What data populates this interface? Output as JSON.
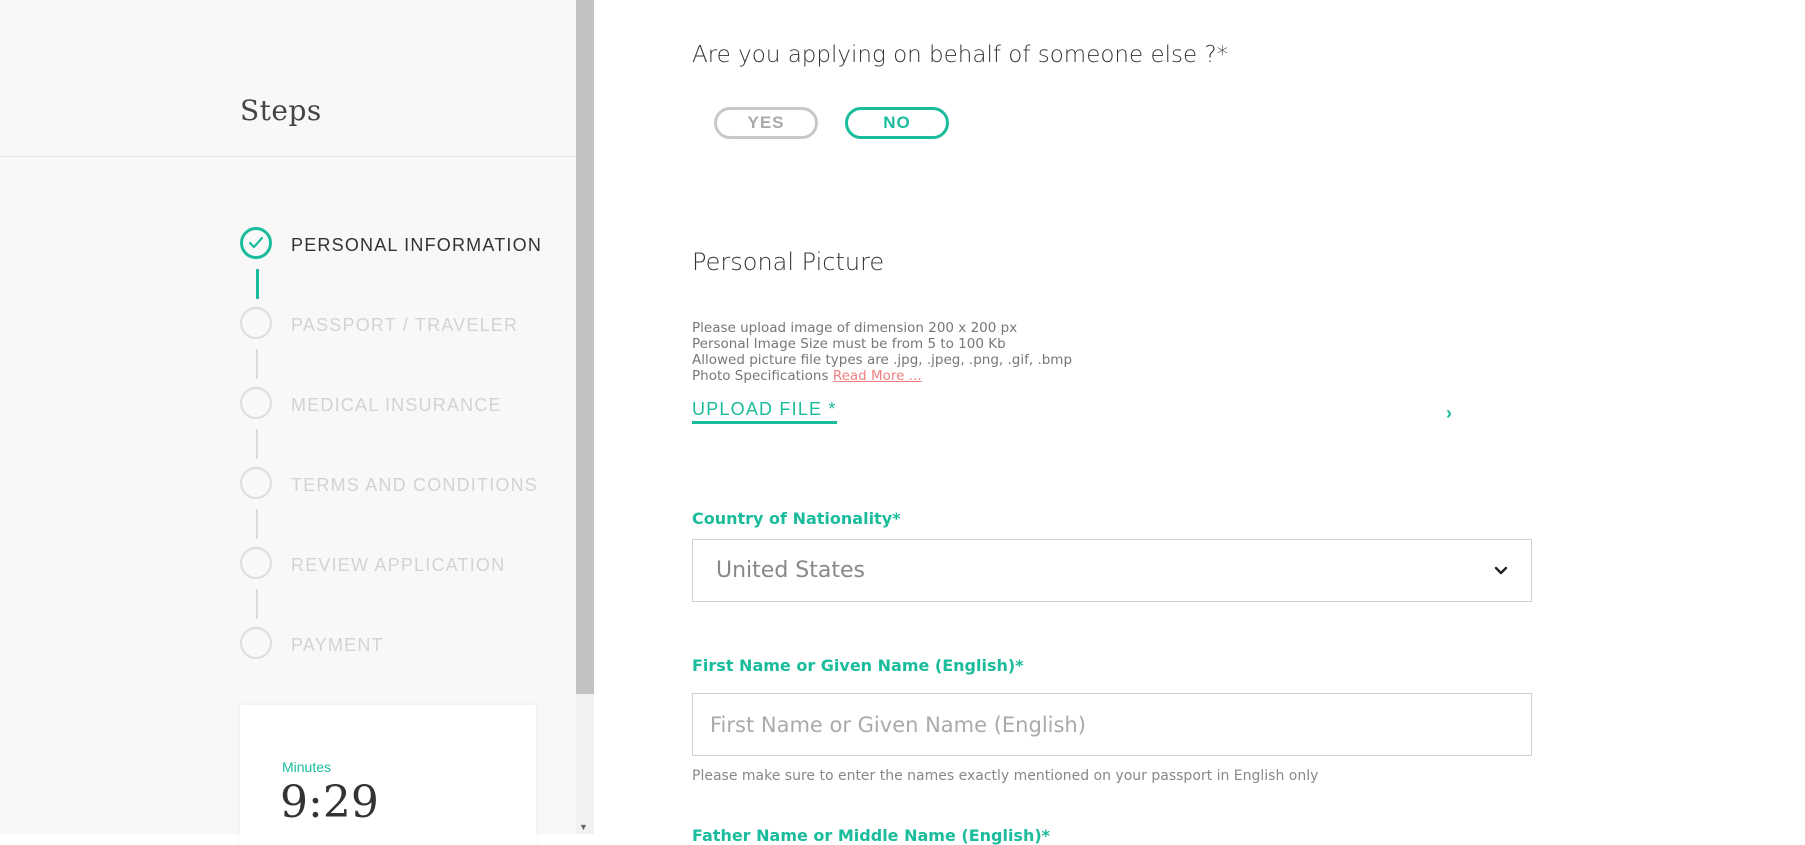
{
  "sidebar": {
    "title": "Steps",
    "steps": [
      {
        "label": "PERSONAL INFORMATION"
      },
      {
        "label": "PASSPORT / TRAVELER"
      },
      {
        "label": "MEDICAL INSURANCE"
      },
      {
        "label": "TERMS AND CONDITIONS"
      },
      {
        "label": "REVIEW APPLICATION"
      },
      {
        "label": "PAYMENT"
      }
    ],
    "active_step": 1,
    "timer": {
      "label": "Minutes",
      "value": "9:29"
    }
  },
  "form": {
    "behalf_question": "Are you applying on behalf of someone else ?*",
    "yes_label": "YES",
    "no_label": "NO",
    "selected": "NO",
    "picture": {
      "title": "Personal Picture",
      "lines": [
        "Please upload image of dimension 200 x 200 px",
        "Personal Image Size must be from 5 to 100 Kb",
        "Allowed picture file types are .jpg, .jpeg, .png, .gif, .bmp"
      ],
      "spec_prefix": "Photo Specifications ",
      "read_more": "Read More ...",
      "upload_label": "UPLOAD FILE *",
      "chevron": "›"
    },
    "nationality": {
      "label": "Country of Nationality*",
      "value": "United States"
    },
    "first_name": {
      "label": "First Name or Given Name (English)*",
      "placeholder": "First Name or Given Name (English)",
      "hint": "Please make sure to enter the names exactly mentioned on your passport in English only"
    },
    "next_label": "Father Name or Middle Name (English)*"
  },
  "colors": {
    "accent": "#1abc9c",
    "link": "#f08080"
  }
}
